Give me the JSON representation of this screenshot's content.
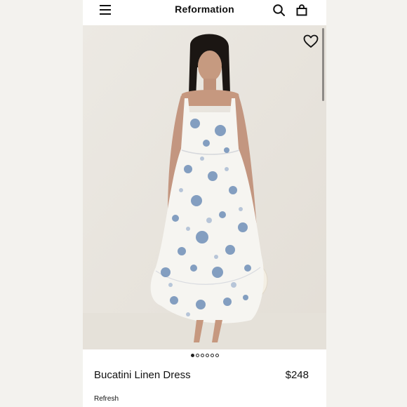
{
  "header": {
    "brand": "Reformation",
    "icons": [
      "menu-icon",
      "search-icon",
      "shopping-bag-icon"
    ]
  },
  "product": {
    "name": "Bucatini Linen Dress",
    "price": "$248",
    "collection": "Refresh",
    "favorite_icon": "heart-icon",
    "image_pagination": {
      "total": 6,
      "active": 1
    }
  },
  "colors": {
    "page_background": "#f4f3ef",
    "card_background": "#ffffff",
    "photo_background": "#e9e6df",
    "print_blue": "#6f8fb8",
    "text": "#111111"
  }
}
